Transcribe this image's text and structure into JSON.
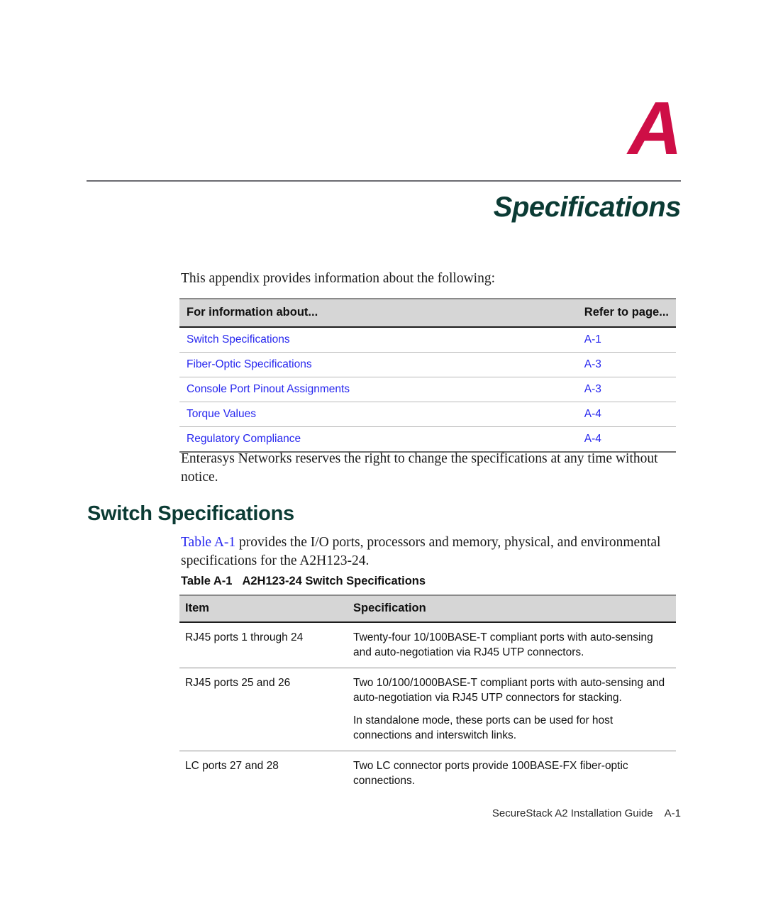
{
  "header": {
    "appendix_letter": "A",
    "chapter_title": "Specifications"
  },
  "intro": {
    "line": "This appendix provides information about the following:"
  },
  "toc": {
    "columns": [
      "For information about...",
      "Refer to page..."
    ],
    "rows": [
      {
        "topic": "Switch Specifications",
        "page": "A-1"
      },
      {
        "topic": "Fiber-Optic Specifications",
        "page": "A-3"
      },
      {
        "topic": "Console Port Pinout Assignments",
        "page": "A-3"
      },
      {
        "topic": "Torque Values",
        "page": "A-4"
      },
      {
        "topic": "Regulatory Compliance",
        "page": "A-4"
      }
    ]
  },
  "notice": {
    "text": "Enterasys Networks reserves the right to change the specifications at any time without notice."
  },
  "section": {
    "heading": "Switch Specifications",
    "para_xref": "Table A-1",
    "para_rest": " provides the I/O ports, processors and memory, physical, and environmental specifications for the A2H123-24."
  },
  "spec_table": {
    "caption_number": "Table A-1",
    "caption_title": "A2H123-24 Switch Specifications",
    "columns": [
      "Item",
      "Specification"
    ],
    "rows": [
      {
        "item": "RJ45 ports 1 through 24",
        "spec": [
          "Twenty-four 10/100BASE-T compliant ports with auto-sensing and auto-negotiation via RJ45 UTP connectors."
        ]
      },
      {
        "item": "RJ45 ports 25 and 26",
        "spec": [
          "Two 10/100/1000BASE-T compliant ports with auto-sensing and auto-negotiation via RJ45 UTP connectors for stacking.",
          "In standalone mode, these ports can be used for host connections and interswitch links."
        ]
      },
      {
        "item": "LC ports 27 and 28",
        "spec": [
          "Two LC connector ports provide 100BASE-FX fiber-optic connections."
        ]
      }
    ]
  },
  "footer": {
    "guide": "SecureStack A2 Installation Guide",
    "page": "A-1"
  },
  "colors": {
    "appendix_red": "#CE0E46",
    "title_green": "#0B3B34",
    "link_blue": "#2727EF",
    "table_header_gray": "#D6D6D6"
  }
}
